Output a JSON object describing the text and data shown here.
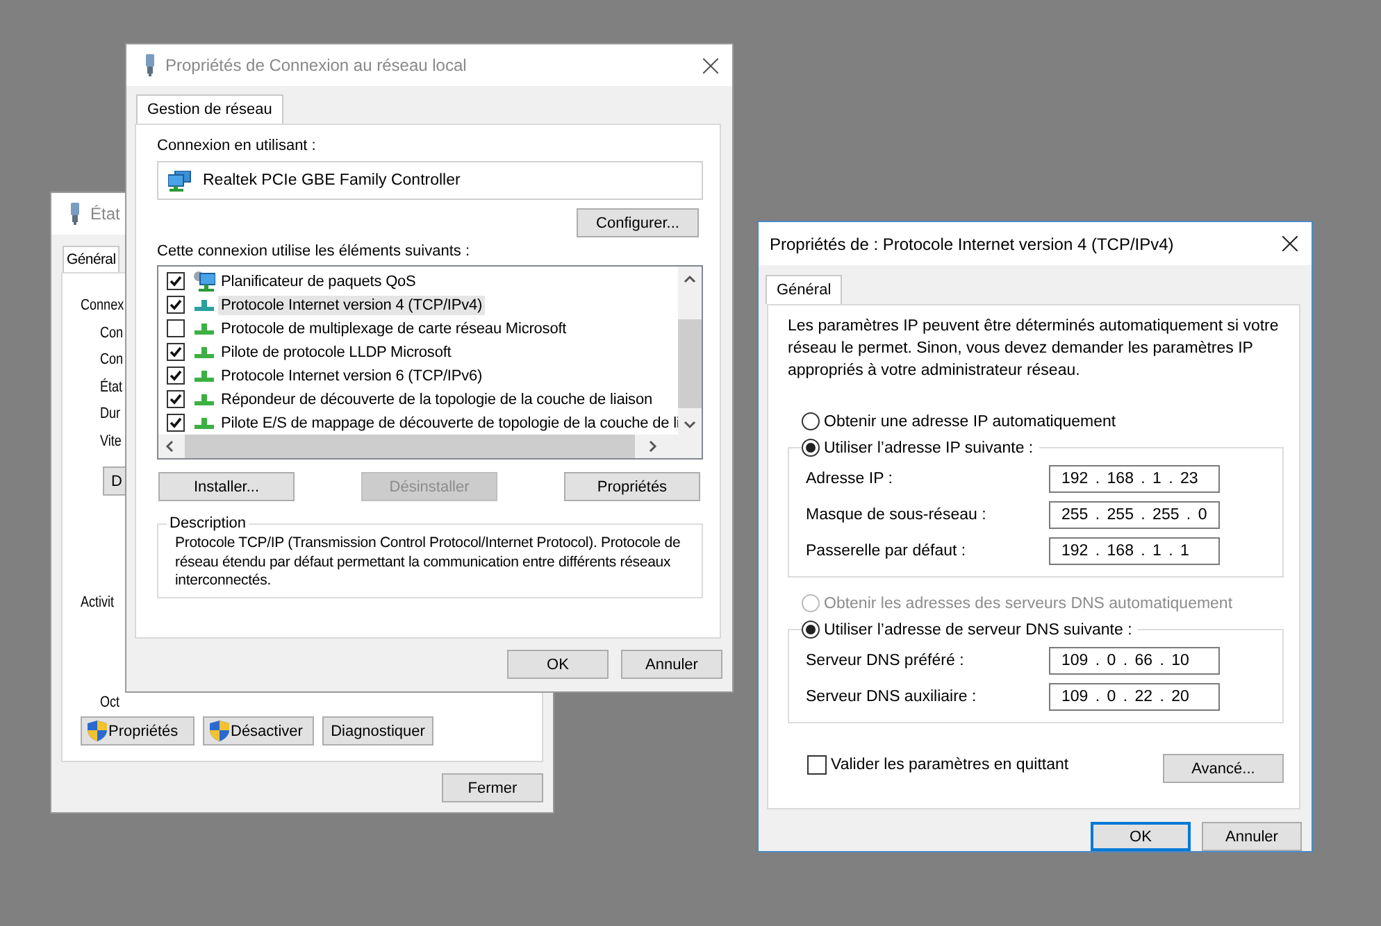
{
  "status_window": {
    "title": "État",
    "active": false,
    "tabs": [
      {
        "label": "Général",
        "selected": true
      }
    ],
    "sections": [
      {
        "heading": "Connex",
        "children": [
          "Con",
          "Con",
          "État",
          "Dur",
          "Vite"
        ]
      },
      {
        "heading": "Activit",
        "children": [
          "Oct"
        ]
      }
    ],
    "partial_button": "D",
    "buttons": [
      {
        "label": "Propriétés",
        "shield": true
      },
      {
        "label": "Désactiver",
        "shield": true
      },
      {
        "label": "Diagnostiquer",
        "shield": false
      }
    ],
    "close_button": "Fermer"
  },
  "lan_window": {
    "title": "Propriétés de Connexion au réseau local",
    "active": false,
    "tabs": [
      {
        "label": "Gestion de réseau",
        "selected": true
      }
    ],
    "connect_label": "Connexion en utilisant :",
    "adapter": "Realtek PCIe GBE Family Controller",
    "configure_button": "Configurer...",
    "items_label": "Cette connexion utilise les éléments suivants :",
    "items": [
      {
        "label": "Planificateur de paquets QoS",
        "checked": true,
        "selected": false,
        "kind": "scheduler"
      },
      {
        "label": "Protocole Internet version 4 (TCP/IPv4)",
        "checked": true,
        "selected": true,
        "kind": "protocol"
      },
      {
        "label": "Protocole de multiplexage de carte réseau Microsoft",
        "checked": false,
        "selected": false,
        "kind": "protocol"
      },
      {
        "label": "Pilote de protocole LLDP Microsoft",
        "checked": true,
        "selected": false,
        "kind": "protocol"
      },
      {
        "label": "Protocole Internet version 6 (TCP/IPv6)",
        "checked": true,
        "selected": false,
        "kind": "protocol"
      },
      {
        "label": "Répondeur de découverte de la topologie de la couche de liaison",
        "checked": true,
        "selected": false,
        "kind": "protocol"
      },
      {
        "label": "Pilote E/S de mappage de découverte de topologie de la couche de li",
        "checked": true,
        "selected": false,
        "kind": "protocol"
      }
    ],
    "action_buttons": [
      {
        "label": "Installer...",
        "disabled": false
      },
      {
        "label": "Désinstaller",
        "disabled": true
      },
      {
        "label": "Propriétés",
        "disabled": false
      }
    ],
    "description": {
      "legend": "Description",
      "text": "Protocole TCP/IP (Transmission Control Protocol/Internet Protocol). Protocole de réseau étendu par défaut permettant la communication entre différents réseaux interconnectés."
    },
    "buttons": [
      {
        "label": "OK",
        "default": false
      },
      {
        "label": "Annuler",
        "default": false
      }
    ]
  },
  "ipv4_window": {
    "title": "Propriétés de : Protocole Internet version 4 (TCP/IPv4)",
    "active": true,
    "tabs": [
      {
        "label": "Général",
        "selected": true
      }
    ],
    "intro": "Les paramètres IP peuvent être déterminés automatiquement si votre réseau le permet. Sinon, vous devez demander les paramètres IP appropriés à votre administrateur réseau.",
    "ip_auto": {
      "label": "Obtenir une adresse IP automatiquement",
      "selected": false,
      "disabled": false
    },
    "ip_manual": {
      "label": "Utiliser l’adresse IP suivante :",
      "selected": true,
      "fields": [
        {
          "label": "Adresse IP :",
          "value": "192 . 168 . 1 . 23"
        },
        {
          "label": "Masque de sous-réseau :",
          "value": "255 . 255 . 255 . 0"
        },
        {
          "label": "Passerelle par défaut :",
          "value": "192 . 168 . 1 . 1"
        }
      ]
    },
    "dns_auto": {
      "label": "Obtenir les adresses des serveurs DNS automatiquement",
      "selected": false,
      "disabled": true
    },
    "dns_manual": {
      "label": "Utiliser l’adresse de serveur DNS suivante :",
      "selected": true,
      "fields": [
        {
          "label": "Serveur DNS préféré :",
          "value": "109 . 0 . 66 . 10"
        },
        {
          "label": "Serveur DNS auxiliaire :",
          "value": "109 . 0 . 22 . 20"
        }
      ]
    },
    "validate": {
      "label": "Valider les paramètres en quittant",
      "checked": false
    },
    "advanced_button": "Avancé...",
    "buttons": [
      {
        "label": "OK",
        "default": true
      },
      {
        "label": "Annuler",
        "default": false
      }
    ]
  }
}
